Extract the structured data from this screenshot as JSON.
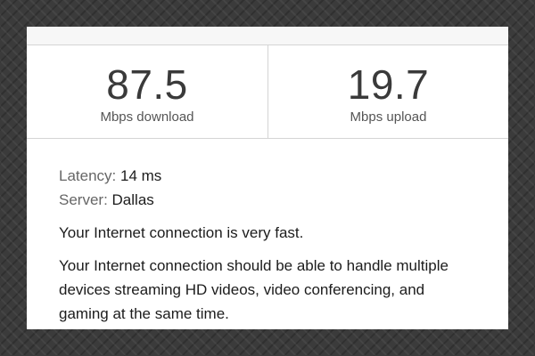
{
  "results": {
    "download": {
      "value": "87.5",
      "unit": "Mbps download"
    },
    "upload": {
      "value": "19.7",
      "unit": "Mbps upload"
    }
  },
  "details": {
    "latency_label": "Latency:",
    "latency_value": "14 ms",
    "server_label": "Server:",
    "server_value": "Dallas"
  },
  "message": "Your Internet connection is very fast.",
  "description": "Your Internet connection should be able to handle multiple devices streaming HD videos, video conferencing, and gaming at the same time."
}
